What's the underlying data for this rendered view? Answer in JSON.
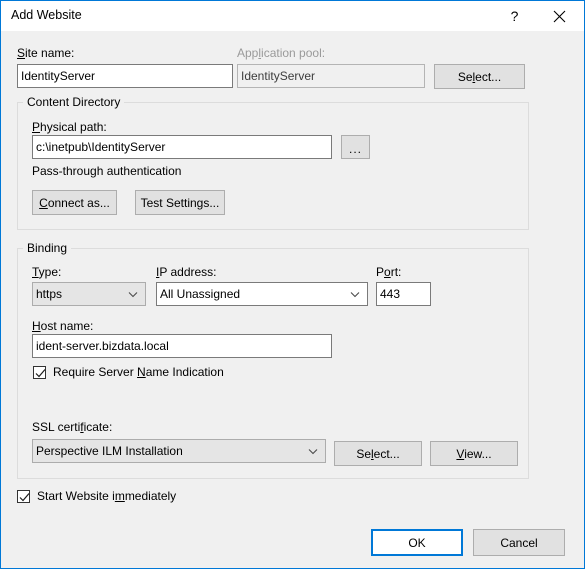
{
  "window": {
    "title": "Add Website",
    "help_tooltip": "?",
    "close_tooltip": "✕",
    "accent_color": "#0078d7",
    "titlebar_bg": "#ffffff",
    "body_bg": "#f0f0f0"
  },
  "site_name": {
    "label_pre": "S",
    "label_accel": "S",
    "label": "Site name:",
    "value": "IdentityServer"
  },
  "app_pool": {
    "label": "Application pool:",
    "value": "IdentityServer",
    "select_button": "Select..."
  },
  "content_directory": {
    "group_label": "Content Directory",
    "physical_path_label": "Physical path:",
    "physical_path_value": "c:\\inetpub\\IdentityServer",
    "browse_button": "...",
    "auth_text": "Pass-through authentication",
    "connect_as_button": "Connect as...",
    "test_settings_button": "Test Settings..."
  },
  "binding": {
    "group_label": "Binding",
    "type_label": "Type:",
    "type_value": "https",
    "ip_label": "IP address:",
    "ip_value": "All Unassigned",
    "port_label": "Port:",
    "port_value": "443",
    "host_label": "Host name:",
    "host_value": "ident-server.bizdata.local",
    "sni_label": "Require Server Name Indication",
    "sni_checked": true,
    "ssl_label": "SSL certificate:",
    "ssl_value": "Perspective ILM Installation",
    "ssl_select_button": "Select...",
    "ssl_view_button": "View..."
  },
  "footer": {
    "start_label": "Start Website immediately",
    "start_checked": true,
    "ok_button": "OK",
    "cancel_button": "Cancel"
  }
}
